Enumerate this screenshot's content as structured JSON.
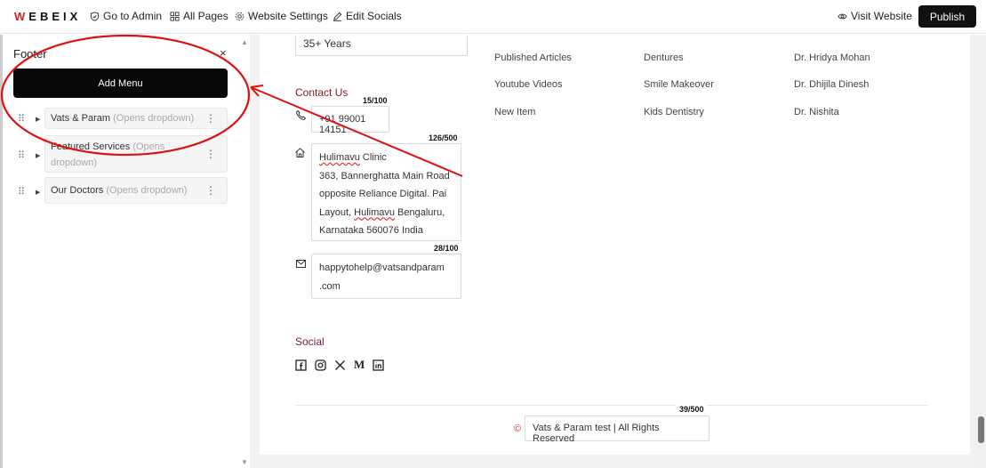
{
  "topbar": {
    "logo": "WEBEIX",
    "nav": [
      {
        "label": "Go to Admin",
        "icon": "shield-icon"
      },
      {
        "label": "All Pages",
        "icon": "grid-icon"
      },
      {
        "label": "Website Settings",
        "icon": "gear-icon"
      },
      {
        "label": "Edit Socials",
        "icon": "pencil-icon"
      }
    ],
    "visit_website": "Visit Website",
    "publish": "Publish"
  },
  "sidebar": {
    "title": "Footer",
    "close": "×",
    "add_menu": "Add Menu",
    "items": [
      {
        "label": "Vats & Param",
        "hint": "(Opens dropdown)"
      },
      {
        "label": "Featured Services",
        "hint": "(Opens dropdown)"
      },
      {
        "label": "Our Doctors",
        "hint": "(Opens dropdown)"
      }
    ]
  },
  "footer": {
    "experience_value": "35+ Years",
    "columns": [
      [
        "Published Articles",
        "Youtube Videos",
        "New Item"
      ],
      [
        "Dentures",
        "Smile Makeover",
        "Kids Dentistry"
      ],
      [
        "Dr. Hridya Mohan",
        "Dr. Dhijila Dinesh",
        "Dr. Nishita"
      ]
    ],
    "contact": {
      "title": "Contact Us",
      "phone": "+91 99001 14151",
      "phone_counter": "15/100",
      "address_lines": [
        "Hulimavu Clinic",
        "363, Bannerghatta Main Road",
        "opposite Reliance Digital. Pai",
        "Layout, Hulimavu Bengaluru,",
        "Karnataka 560076 India"
      ],
      "address_counter": "126/500",
      "email_lines": [
        "happytohelp@vatsandparam",
        ".com"
      ],
      "email_counter": "28/100"
    },
    "social": {
      "title": "Social",
      "icons": [
        "facebook-icon",
        "instagram-icon",
        "x-icon",
        "medium-icon",
        "linkedin-icon"
      ]
    },
    "copyright_symbol": "©",
    "copyright": "Vats & Param test | All Rights Reserved",
    "copyright_counter": "39/500"
  },
  "colors": {
    "accent": "#7a1c2a",
    "annotation": "#e01010",
    "primary_button": "#111111"
  }
}
